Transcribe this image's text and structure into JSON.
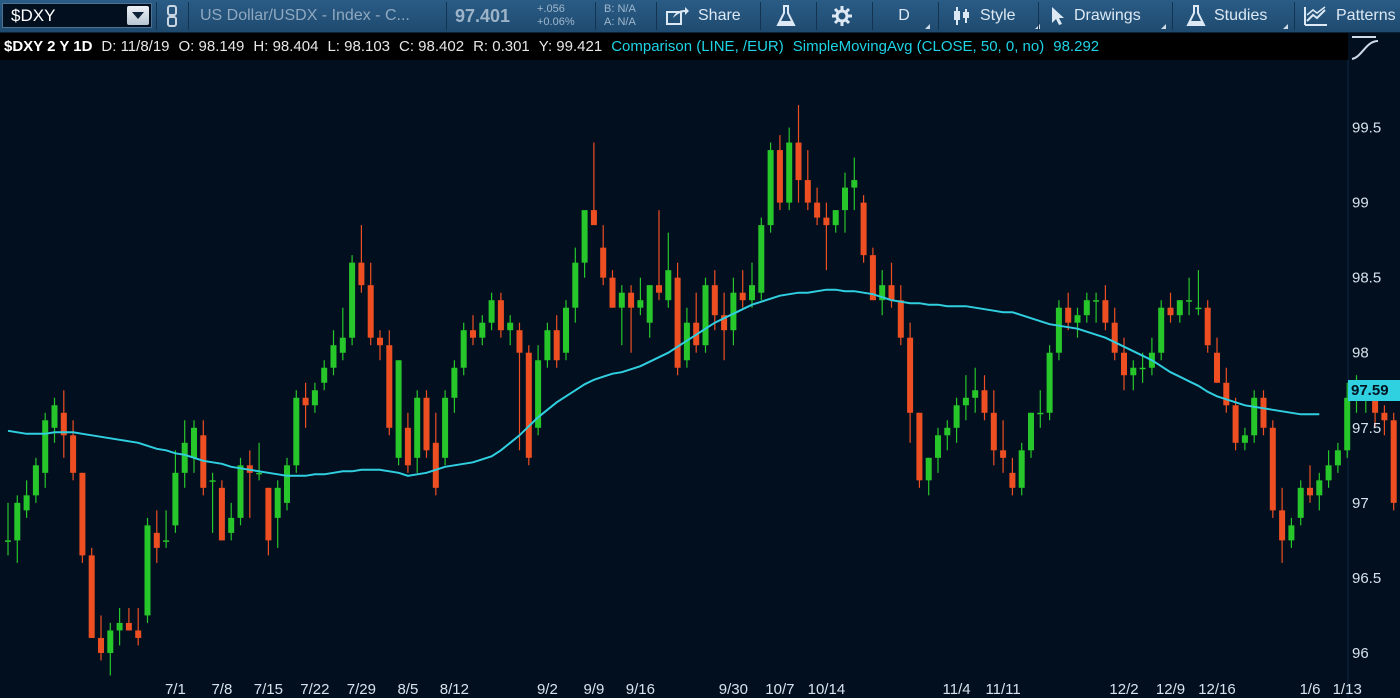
{
  "toolbar": {
    "symbol": "$DXY",
    "description": "US Dollar/USDX - Index - C...",
    "last_price": "97.401",
    "net_change": "+.056",
    "pct_change": "+0.06%",
    "bid": "B: N/A",
    "ask": "A: N/A",
    "share_label": "Share",
    "aggregation_label": "D",
    "style_label": "Style",
    "drawings_label": "Drawings",
    "studies_label": "Studies",
    "patterns_label": "Patterns"
  },
  "infobar": {
    "symbol_period": "$DXY 2 Y 1D",
    "date": "D: 11/8/19",
    "open": "O: 98.149",
    "high": "H: 98.404",
    "low": "L: 98.103",
    "close": "C: 98.402",
    "range": "R: 0.301",
    "y_value": "Y: 99.421",
    "comparison": "Comparison (LINE, /EUR)",
    "sma": "SimpleMovingAvg (CLOSE, 50, 0, no)",
    "sma_value": "98.292"
  },
  "colors": {
    "background": "#020f1f",
    "up_candle": "#27c62a",
    "down_candle": "#ee4f22",
    "sma_line": "#30cfe0"
  },
  "chart_data": {
    "type": "candlestick",
    "ylim": [
      95.7,
      99.95
    ],
    "y_ticks": [
      96,
      96.5,
      97,
      97.5,
      98,
      98.5,
      99,
      99.5
    ],
    "x_labels": [
      {
        "label": "7/1",
        "index": 18
      },
      {
        "label": "7/8",
        "index": 23
      },
      {
        "label": "7/15",
        "index": 28
      },
      {
        "label": "7/22",
        "index": 33
      },
      {
        "label": "7/29",
        "index": 38
      },
      {
        "label": "8/5",
        "index": 43
      },
      {
        "label": "8/12",
        "index": 48
      },
      {
        "label": "9/2",
        "index": 58
      },
      {
        "label": "9/9",
        "index": 63
      },
      {
        "label": "9/16",
        "index": 68
      },
      {
        "label": "9/30",
        "index": 78
      },
      {
        "label": "10/7",
        "index": 83
      },
      {
        "label": "10/14",
        "index": 88
      },
      {
        "label": "11/4",
        "index": 102
      },
      {
        "label": "11/11",
        "index": 107
      },
      {
        "label": "12/2",
        "index": 120
      },
      {
        "label": "12/9",
        "index": 125
      },
      {
        "label": "12/16",
        "index": 130
      },
      {
        "label": "1/6",
        "index": 140
      },
      {
        "label": "1/13",
        "index": 144
      }
    ],
    "last_price_label": "97.59",
    "candles": [
      [
        96.75,
        97.0,
        96.65,
        96.75
      ],
      [
        96.75,
        97.05,
        96.6,
        97.0
      ],
      [
        96.95,
        97.15,
        96.9,
        97.05
      ],
      [
        97.05,
        97.3,
        97.0,
        97.25
      ],
      [
        97.2,
        97.6,
        97.1,
        97.55
      ],
      [
        97.5,
        97.7,
        97.4,
        97.65
      ],
      [
        97.6,
        97.75,
        97.3,
        97.45
      ],
      [
        97.45,
        97.55,
        97.15,
        97.2
      ],
      [
        97.2,
        97.2,
        96.6,
        96.65
      ],
      [
        96.65,
        96.7,
        96.1,
        96.1
      ],
      [
        96.1,
        96.25,
        95.95,
        96.0
      ],
      [
        96.0,
        96.2,
        95.85,
        96.15
      ],
      [
        96.15,
        96.3,
        96.05,
        96.2
      ],
      [
        96.2,
        96.3,
        96.15,
        96.15
      ],
      [
        96.15,
        96.3,
        96.05,
        96.1
      ],
      [
        96.25,
        96.9,
        96.2,
        96.85
      ],
      [
        96.8,
        96.95,
        96.6,
        96.7
      ],
      [
        96.75,
        96.95,
        96.7,
        96.75
      ],
      [
        96.85,
        97.35,
        96.8,
        97.2
      ],
      [
        97.2,
        97.55,
        97.1,
        97.4
      ],
      [
        97.3,
        97.55,
        97.2,
        97.5
      ],
      [
        97.45,
        97.55,
        97.05,
        97.1
      ],
      [
        97.15,
        97.2,
        96.8,
        97.15
      ],
      [
        97.1,
        97.15,
        96.75,
        96.75
      ],
      [
        96.8,
        97.0,
        96.75,
        96.9
      ],
      [
        96.9,
        97.3,
        96.85,
        97.25
      ],
      [
        97.25,
        97.35,
        96.9,
        97.2
      ],
      [
        97.2,
        97.4,
        97.15,
        97.2
      ],
      [
        97.1,
        97.1,
        96.65,
        96.75
      ],
      [
        96.9,
        97.15,
        96.7,
        97.1
      ],
      [
        97.0,
        97.3,
        96.95,
        97.25
      ],
      [
        97.25,
        97.75,
        97.2,
        97.7
      ],
      [
        97.7,
        97.8,
        97.5,
        97.65
      ],
      [
        97.65,
        97.8,
        97.6,
        97.75
      ],
      [
        97.8,
        97.95,
        97.75,
        97.9
      ],
      [
        97.9,
        98.15,
        97.85,
        98.05
      ],
      [
        98.0,
        98.3,
        97.95,
        98.1
      ],
      [
        98.1,
        98.65,
        98.05,
        98.6
      ],
      [
        98.6,
        98.85,
        98.4,
        98.45
      ],
      [
        98.45,
        98.6,
        98.05,
        98.1
      ],
      [
        98.1,
        98.15,
        97.95,
        98.05
      ],
      [
        98.05,
        98.15,
        97.45,
        97.5
      ],
      [
        97.3,
        97.95,
        97.25,
        97.95
      ],
      [
        97.5,
        97.6,
        97.2,
        97.25
      ],
      [
        97.3,
        97.75,
        97.2,
        97.7
      ],
      [
        97.7,
        97.75,
        97.3,
        97.35
      ],
      [
        97.4,
        97.6,
        97.05,
        97.1
      ],
      [
        97.3,
        97.75,
        97.25,
        97.7
      ],
      [
        97.7,
        97.95,
        97.6,
        97.9
      ],
      [
        97.9,
        98.2,
        97.85,
        98.15
      ],
      [
        98.15,
        98.25,
        98.05,
        98.1
      ],
      [
        98.1,
        98.25,
        98.05,
        98.2
      ],
      [
        98.2,
        98.4,
        98.15,
        98.35
      ],
      [
        98.35,
        98.4,
        98.1,
        98.15
      ],
      [
        98.15,
        98.25,
        98.05,
        98.2
      ],
      [
        98.15,
        98.2,
        97.35,
        98.0
      ],
      [
        98.0,
        98.05,
        97.25,
        97.3
      ],
      [
        97.5,
        98.05,
        97.45,
        97.95
      ],
      [
        97.95,
        98.2,
        97.9,
        98.15
      ],
      [
        98.15,
        98.25,
        97.9,
        97.95
      ],
      [
        98.0,
        98.35,
        97.95,
        98.3
      ],
      [
        98.3,
        98.7,
        98.2,
        98.6
      ],
      [
        98.6,
        98.9,
        98.5,
        98.95
      ],
      [
        98.95,
        99.4,
        98.9,
        98.85
      ],
      [
        98.7,
        98.85,
        98.45,
        98.5
      ],
      [
        98.5,
        98.55,
        98.3,
        98.3
      ],
      [
        98.3,
        98.45,
        98.05,
        98.4
      ],
      [
        98.4,
        98.45,
        98.0,
        98.3
      ],
      [
        98.3,
        98.5,
        98.25,
        98.35
      ],
      [
        98.2,
        98.45,
        98.1,
        98.45
      ],
      [
        98.45,
        98.95,
        98.35,
        98.4
      ],
      [
        98.35,
        98.8,
        98.3,
        98.55
      ],
      [
        98.5,
        98.6,
        97.85,
        97.9
      ],
      [
        97.95,
        98.3,
        97.9,
        98.2
      ],
      [
        98.2,
        98.4,
        98.0,
        98.05
      ],
      [
        98.05,
        98.5,
        98.0,
        98.45
      ],
      [
        98.45,
        98.55,
        98.15,
        98.25
      ],
      [
        98.25,
        98.4,
        97.95,
        98.15
      ],
      [
        98.15,
        98.5,
        98.05,
        98.4
      ],
      [
        98.4,
        98.55,
        98.3,
        98.35
      ],
      [
        98.35,
        98.6,
        98.3,
        98.45
      ],
      [
        98.4,
        98.9,
        98.35,
        98.85
      ],
      [
        98.85,
        99.4,
        98.8,
        99.35
      ],
      [
        99.35,
        99.45,
        98.95,
        99.0
      ],
      [
        99.0,
        99.5,
        98.95,
        99.4
      ],
      [
        99.4,
        99.65,
        99.0,
        99.15
      ],
      [
        99.15,
        99.35,
        98.95,
        99.0
      ],
      [
        99.0,
        99.1,
        98.85,
        98.9
      ],
      [
        98.9,
        99.0,
        98.55,
        98.85
      ],
      [
        98.85,
        98.95,
        98.8,
        98.95
      ],
      [
        98.95,
        99.2,
        98.8,
        99.1
      ],
      [
        99.1,
        99.3,
        98.95,
        99.15
      ],
      [
        99.0,
        99.05,
        98.6,
        98.65
      ],
      [
        98.65,
        98.7,
        98.4,
        98.35
      ],
      [
        98.35,
        98.55,
        98.25,
        98.45
      ],
      [
        98.45,
        98.6,
        98.3,
        98.35
      ],
      [
        98.35,
        98.45,
        98.05,
        98.1
      ],
      [
        98.1,
        98.2,
        97.4,
        97.6
      ],
      [
        97.6,
        97.6,
        97.1,
        97.15
      ],
      [
        97.15,
        97.3,
        97.05,
        97.3
      ],
      [
        97.3,
        97.5,
        97.2,
        97.45
      ],
      [
        97.45,
        97.55,
        97.35,
        97.5
      ],
      [
        97.5,
        97.7,
        97.4,
        97.65
      ],
      [
        97.65,
        97.85,
        97.55,
        97.7
      ],
      [
        97.7,
        97.9,
        97.6,
        97.75
      ],
      [
        97.75,
        97.85,
        97.55,
        97.6
      ],
      [
        97.6,
        97.75,
        97.25,
        97.35
      ],
      [
        97.35,
        97.55,
        97.2,
        97.3
      ],
      [
        97.2,
        97.3,
        97.05,
        97.1
      ],
      [
        97.1,
        97.4,
        97.05,
        97.35
      ],
      [
        97.35,
        97.6,
        97.3,
        97.6
      ],
      [
        97.6,
        97.75,
        97.5,
        97.6
      ],
      [
        97.6,
        98.05,
        97.55,
        98.0
      ],
      [
        98.0,
        98.35,
        97.95,
        98.3
      ],
      [
        98.3,
        98.4,
        98.15,
        98.2
      ],
      [
        98.2,
        98.3,
        98.1,
        98.25
      ],
      [
        98.25,
        98.4,
        98.2,
        98.35
      ],
      [
        98.35,
        98.4,
        98.2,
        98.35
      ],
      [
        98.35,
        98.45,
        98.15,
        98.2
      ],
      [
        98.2,
        98.3,
        97.95,
        98.0
      ],
      [
        98.0,
        98.1,
        97.75,
        97.85
      ],
      [
        97.85,
        97.95,
        97.75,
        97.9
      ],
      [
        97.9,
        98.0,
        97.8,
        97.9
      ],
      [
        97.9,
        98.1,
        97.85,
        98.0
      ],
      [
        98.0,
        98.35,
        97.95,
        98.3
      ],
      [
        98.3,
        98.4,
        98.2,
        98.25
      ],
      [
        98.25,
        98.35,
        98.2,
        98.35
      ],
      [
        98.35,
        98.5,
        98.25,
        98.35
      ],
      [
        98.3,
        98.55,
        98.25,
        98.3
      ],
      [
        98.3,
        98.35,
        98.0,
        98.05
      ],
      [
        98.0,
        98.1,
        97.8,
        97.8
      ],
      [
        97.8,
        97.9,
        97.6,
        97.65
      ],
      [
        97.65,
        97.7,
        97.35,
        97.4
      ],
      [
        97.4,
        97.5,
        97.35,
        97.45
      ],
      [
        97.45,
        97.75,
        97.4,
        97.7
      ],
      [
        97.7,
        97.75,
        97.45,
        97.5
      ],
      [
        97.5,
        97.55,
        96.9,
        96.95
      ],
      [
        96.95,
        97.1,
        96.6,
        96.75
      ],
      [
        96.75,
        96.9,
        96.7,
        96.85
      ],
      [
        96.9,
        97.15,
        96.85,
        97.1
      ],
      [
        97.1,
        97.25,
        97.0,
        97.05
      ],
      [
        97.05,
        97.2,
        96.95,
        97.15
      ],
      [
        97.15,
        97.35,
        97.1,
        97.25
      ],
      [
        97.25,
        97.4,
        97.2,
        97.35
      ],
      [
        97.35,
        97.8,
        97.3,
        97.7
      ],
      [
        97.7,
        97.85,
        97.6,
        97.75
      ],
      [
        97.7,
        97.75,
        97.6,
        97.7
      ],
      [
        97.7,
        97.75,
        97.5,
        97.6
      ],
      [
        97.6,
        97.65,
        97.45,
        97.55
      ],
      [
        97.55,
        97.6,
        96.95,
        97.0
      ],
      [
        96.95,
        97.0,
        96.6,
        96.75
      ],
      [
        96.75,
        96.85,
        96.45,
        96.55
      ],
      [
        96.5,
        96.85,
        96.45,
        96.8
      ],
      [
        96.8,
        97.05,
        96.75,
        96.85
      ],
      [
        96.85,
        96.95,
        96.5,
        96.6
      ],
      [
        96.65,
        96.85,
        96.55,
        96.8
      ],
      [
        96.8,
        97.05,
        96.75,
        97.0
      ],
      [
        97.0,
        97.35,
        96.95,
        97.3
      ],
      [
        97.3,
        97.55,
        97.25,
        97.5
      ],
      [
        97.4,
        97.5,
        97.3,
        97.35
      ],
      [
        97.35,
        97.5,
        97.3,
        97.4
      ],
      [
        97.4,
        97.5,
        97.35,
        97.4
      ]
    ],
    "sma": [
      97.48,
      97.47,
      97.46,
      97.46,
      97.46,
      97.47,
      97.47,
      97.47,
      97.46,
      97.45,
      97.44,
      97.43,
      97.42,
      97.41,
      97.4,
      97.38,
      97.36,
      97.35,
      97.33,
      97.32,
      97.3,
      97.28,
      97.27,
      97.26,
      97.24,
      97.23,
      97.22,
      97.21,
      97.2,
      97.19,
      97.18,
      97.18,
      97.18,
      97.19,
      97.19,
      97.2,
      97.21,
      97.21,
      97.22,
      97.22,
      97.22,
      97.21,
      97.2,
      97.18,
      97.19,
      97.2,
      97.22,
      97.24,
      97.25,
      97.26,
      97.27,
      97.29,
      97.31,
      97.35,
      97.4,
      97.45,
      97.51,
      97.57,
      97.62,
      97.67,
      97.71,
      97.75,
      97.79,
      97.82,
      97.84,
      97.86,
      97.87,
      97.89,
      97.91,
      97.94,
      97.97,
      98.0,
      98.04,
      98.08,
      98.12,
      98.16,
      98.2,
      98.23,
      98.26,
      98.29,
      98.32,
      98.34,
      98.36,
      98.38,
      98.39,
      98.4,
      98.4,
      98.41,
      98.42,
      98.42,
      98.41,
      98.41,
      98.4,
      98.39,
      98.37,
      98.35,
      98.34,
      98.33,
      98.33,
      98.32,
      98.32,
      98.31,
      98.31,
      98.31,
      98.3,
      98.29,
      98.28,
      98.27,
      98.27,
      98.25,
      98.23,
      98.21,
      98.19,
      98.18,
      98.17,
      98.16,
      98.14,
      98.12,
      98.1,
      98.07,
      98.04,
      98.01,
      97.98,
      97.95,
      97.91,
      97.87,
      97.84,
      97.81,
      97.78,
      97.74,
      97.71,
      97.69,
      97.67,
      97.65,
      97.64,
      97.63,
      97.62,
      97.61,
      97.6,
      97.59,
      97.59,
      97.59
    ]
  }
}
